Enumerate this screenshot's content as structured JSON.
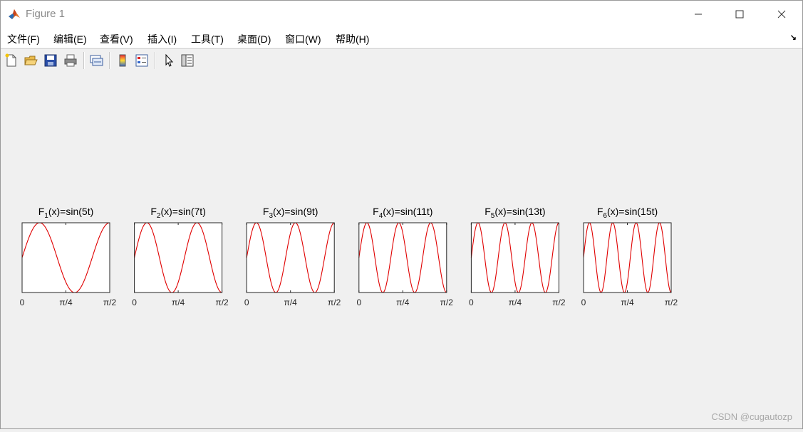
{
  "window": {
    "title": "Figure 1",
    "minimize_icon": "minimize-icon",
    "maximize_icon": "maximize-icon",
    "close_icon": "close-icon"
  },
  "menu": {
    "items": [
      "文件(F)",
      "编辑(E)",
      "查看(V)",
      "插入(I)",
      "工具(T)",
      "桌面(D)",
      "窗口(W)",
      "帮助(H)"
    ],
    "extra_icon": "dock-arrow-icon"
  },
  "toolbar": {
    "icons": [
      "new-figure-icon",
      "open-file-icon",
      "save-icon",
      "print-icon",
      "link-plot-icon",
      "colorbar-icon",
      "legend-icon",
      "pointer-icon",
      "property-editor-icon"
    ]
  },
  "colors": {
    "curve": "#e00000",
    "axes_bg": "#ffffff",
    "figure_bg": "#f0f0f0"
  },
  "chart_data": [
    {
      "type": "line",
      "title_base": "F",
      "title_sub": "1",
      "title_rest": "(x)=sin(5t)",
      "frequency": 5,
      "xlim": [
        0,
        1.5708
      ],
      "ylim": [
        -1,
        1
      ],
      "xticks": [
        0,
        0.7854,
        1.5708
      ],
      "xtick_labels": [
        "0",
        "π/4",
        "π/2"
      ]
    },
    {
      "type": "line",
      "title_base": "F",
      "title_sub": "2",
      "title_rest": "(x)=sin(7t)",
      "frequency": 7,
      "xlim": [
        0,
        1.5708
      ],
      "ylim": [
        -1,
        1
      ],
      "xticks": [
        0,
        0.7854,
        1.5708
      ],
      "xtick_labels": [
        "0",
        "π/4",
        "π/2"
      ]
    },
    {
      "type": "line",
      "title_base": "F",
      "title_sub": "3",
      "title_rest": "(x)=sin(9t)",
      "frequency": 9,
      "xlim": [
        0,
        1.5708
      ],
      "ylim": [
        -1,
        1
      ],
      "xticks": [
        0,
        0.7854,
        1.5708
      ],
      "xtick_labels": [
        "0",
        "π/4",
        "π/2"
      ]
    },
    {
      "type": "line",
      "title_base": "F",
      "title_sub": "4",
      "title_rest": "(x)=sin(11t)",
      "frequency": 11,
      "xlim": [
        0,
        1.5708
      ],
      "ylim": [
        -1,
        1
      ],
      "xticks": [
        0,
        0.7854,
        1.5708
      ],
      "xtick_labels": [
        "0",
        "π/4",
        "π/2"
      ]
    },
    {
      "type": "line",
      "title_base": "F",
      "title_sub": "5",
      "title_rest": "(x)=sin(13t)",
      "frequency": 13,
      "xlim": [
        0,
        1.5708
      ],
      "ylim": [
        -1,
        1
      ],
      "xticks": [
        0,
        0.7854,
        1.5708
      ],
      "xtick_labels": [
        "0",
        "π/4",
        "π/2"
      ]
    },
    {
      "type": "line",
      "title_base": "F",
      "title_sub": "6",
      "title_rest": "(x)=sin(15t)",
      "frequency": 15,
      "xlim": [
        0,
        1.5708
      ],
      "ylim": [
        -1,
        1
      ],
      "xticks": [
        0,
        0.7854,
        1.5708
      ],
      "xtick_labels": [
        "0",
        "π/4",
        "π/2"
      ]
    }
  ],
  "watermark": "CSDN @cugautozp"
}
